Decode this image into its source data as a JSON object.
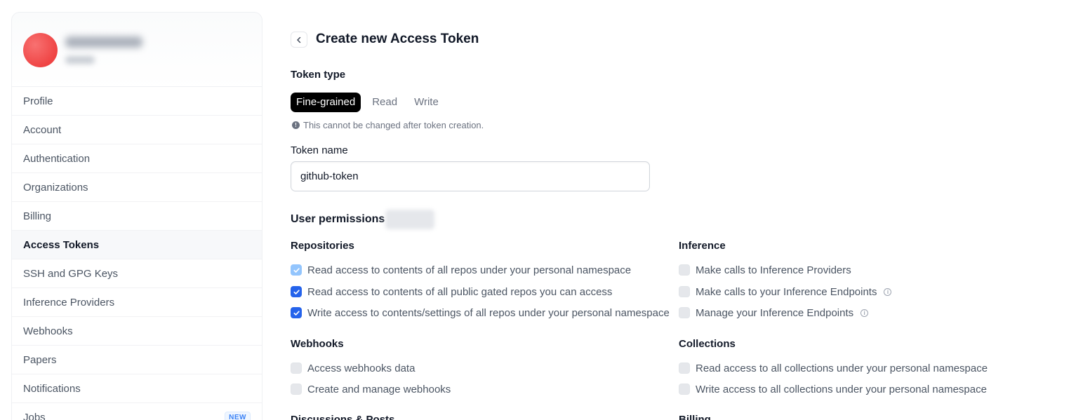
{
  "sidebar": {
    "items": [
      {
        "label": "Profile"
      },
      {
        "label": "Account"
      },
      {
        "label": "Authentication"
      },
      {
        "label": "Organizations"
      },
      {
        "label": "Billing"
      },
      {
        "label": "Access Tokens",
        "active": true
      },
      {
        "label": "SSH and GPG Keys"
      },
      {
        "label": "Inference Providers"
      },
      {
        "label": "Webhooks"
      },
      {
        "label": "Papers"
      },
      {
        "label": "Notifications"
      },
      {
        "label": "Jobs",
        "badge": "NEW"
      }
    ]
  },
  "header": {
    "back_icon": "chevron-left-icon",
    "title": "Create new Access Token"
  },
  "token_type": {
    "label": "Token type",
    "tabs": [
      "Fine-grained",
      "Read",
      "Write"
    ],
    "selected": "Fine-grained",
    "hint": "This cannot be changed after token creation."
  },
  "token_name": {
    "label": "Token name",
    "value": "github-token"
  },
  "user_permissions": {
    "label": "User permissions"
  },
  "repositories": {
    "title": "Repositories",
    "items": [
      {
        "label": "Read access to contents of all repos under your personal namespace",
        "checked": true,
        "disabled": true
      },
      {
        "label": "Read access to contents of all public gated repos you can access",
        "checked": true
      },
      {
        "label": "Write access to contents/settings of all repos under your personal namespace",
        "checked": true
      }
    ]
  },
  "inference": {
    "title": "Inference",
    "items": [
      {
        "label": "Make calls to Inference Providers",
        "checked": false
      },
      {
        "label": "Make calls to your Inference Endpoints",
        "checked": false,
        "info": true
      },
      {
        "label": "Manage your Inference Endpoints",
        "checked": false,
        "info": true
      }
    ]
  },
  "webhooks": {
    "title": "Webhooks",
    "items": [
      {
        "label": "Access webhooks data",
        "checked": false
      },
      {
        "label": "Create and manage webhooks",
        "checked": false
      }
    ]
  },
  "collections": {
    "title": "Collections",
    "items": [
      {
        "label": "Read access to all collections under your personal namespace",
        "checked": false
      },
      {
        "label": "Write access to all collections under your personal namespace",
        "checked": false
      }
    ]
  },
  "more_sections": {
    "discussions": "Discussions & Posts",
    "billing": "Billing"
  },
  "colors": {
    "accent": "#2563eb",
    "avatar": "#ef4444",
    "active_tab": "#000000"
  }
}
